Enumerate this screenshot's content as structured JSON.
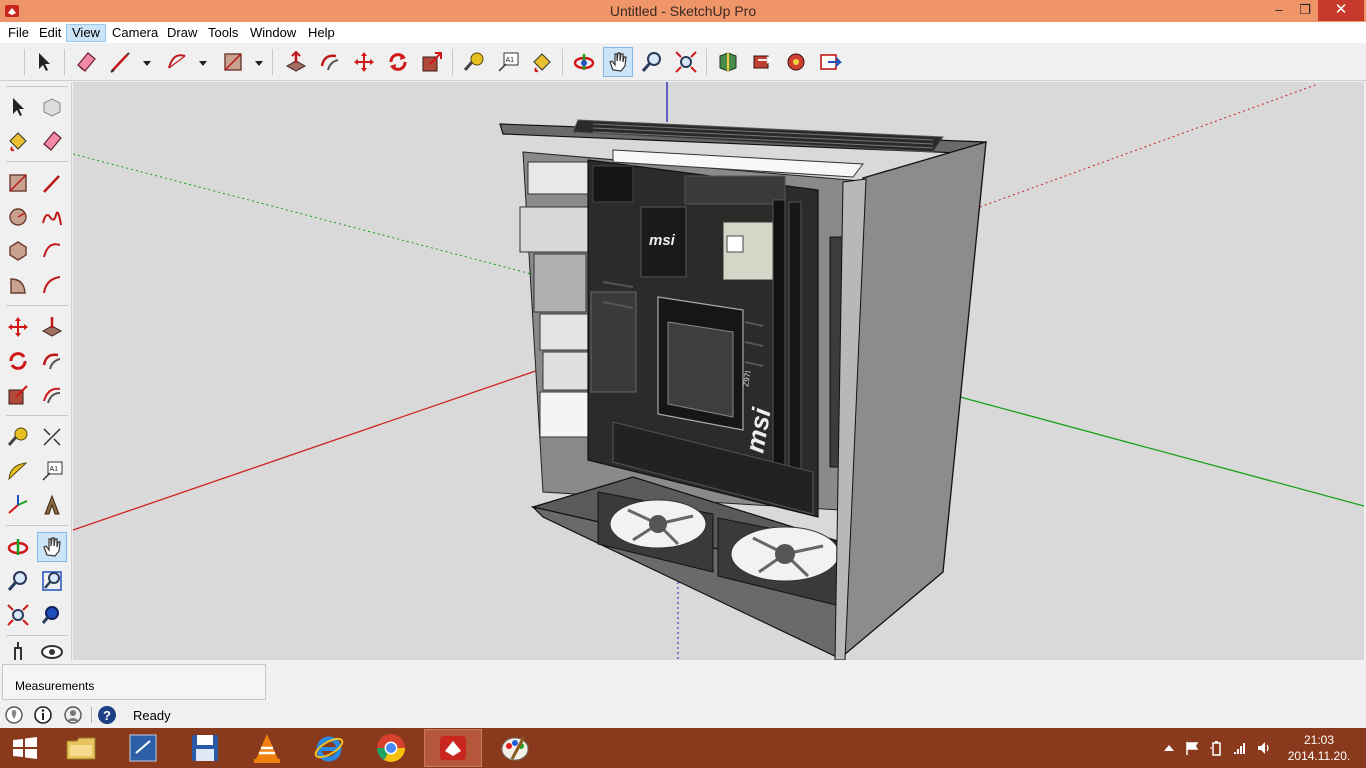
{
  "window": {
    "title": "Untitled - SketchUp Pro",
    "min_glyph": "–",
    "max_glyph": "❐",
    "close_glyph": "✕"
  },
  "menu": [
    "File",
    "Edit",
    "View",
    "Camera",
    "Draw",
    "Tools",
    "Window",
    "Help"
  ],
  "menu_active": "View",
  "toolbar": {
    "items": [
      "select-icon",
      "eraser-icon",
      "line-icon",
      "arc-icon",
      "rectangle-icon",
      "push-pull-icon",
      "follow-me-icon",
      "move-icon",
      "rotate-icon",
      "scale-icon",
      "tape-measure-icon",
      "text-icon",
      "paint-bucket-icon",
      "orbit-icon",
      "pan-icon",
      "zoom-icon",
      "zoom-extents-icon",
      "3d-warehouse-icon",
      "share-model-icon",
      "extension-warehouse-icon",
      "layout-icon"
    ],
    "active": "pan-icon"
  },
  "left_toolbar": {
    "items": [
      "select-icon",
      "make-component-icon",
      "paint-bucket-icon",
      "eraser-icon",
      "rectangle-icon",
      "line-icon",
      "circle-icon",
      "freehand-icon",
      "polygon-icon",
      "arc-icon",
      "pie-icon",
      "two-point-arc-icon",
      "move-icon",
      "push-pull-icon",
      "rotate-icon",
      "follow-me-icon",
      "scale-icon",
      "offset-icon",
      "tape-measure-icon",
      "dimension-icon",
      "protractor-icon",
      "text-icon",
      "axes-icon",
      "3d-text-icon",
      "orbit-icon",
      "pan-icon",
      "zoom-icon",
      "zoom-window-icon",
      "zoom-extents-icon",
      "previous-view-icon",
      "position-camera-icon",
      "look-around-icon"
    ],
    "active": "pan-icon"
  },
  "measurements": {
    "label": "Measurements",
    "value": ""
  },
  "status": {
    "text": "Ready"
  },
  "taskbar": {
    "apps": [
      "windows-start-icon",
      "file-explorer-icon",
      "notes-app-icon",
      "save-app-icon",
      "vlc-icon",
      "internet-explorer-icon",
      "chrome-icon",
      "sketchup-icon",
      "paint-icon"
    ],
    "active": "sketchup-icon",
    "clock_time": "21:03",
    "clock_date": "2014.11.20."
  },
  "colors": {
    "titlebar": "#f0956a",
    "taskbar": "#8a3a1c",
    "viewport": "#d9d9d9",
    "axis_red": "#d02020",
    "axis_green": "#18a018",
    "axis_blue": "#2020c0"
  },
  "model": {
    "brand_label": "msi",
    "sku_label": "Z97I"
  }
}
